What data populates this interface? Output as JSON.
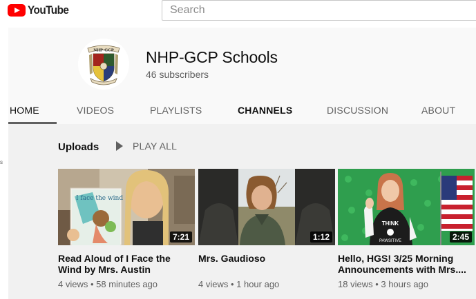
{
  "topbar": {
    "logo_text": "YouTube",
    "search_placeholder": "Search"
  },
  "channel": {
    "name": "NHP-GCP Schools",
    "subscribers": "46 subscribers",
    "crest_text": "NHP-GCP"
  },
  "tabs": [
    {
      "label": "HOME",
      "active": true
    },
    {
      "label": "VIDEOS"
    },
    {
      "label": "PLAYLISTS"
    },
    {
      "label": "CHANNELS"
    },
    {
      "label": "DISCUSSION"
    },
    {
      "label": "ABOUT"
    }
  ],
  "left_stub": "s",
  "uploads": {
    "title": "Uploads",
    "play_all": "PLAY ALL"
  },
  "videos": [
    {
      "title": "Read Aloud of I Face the Wind by Mrs. Austin",
      "meta": "4 views • 58 minutes ago",
      "duration": "7:21",
      "book_text": "I face the wind"
    },
    {
      "title": "Mrs. Gaudioso",
      "meta": "4 views • 1 hour ago",
      "duration": "1:12"
    },
    {
      "title": "Hello, HGS! 3/25 Morning Announcements with Mrs....",
      "meta": "18 views • 3 hours ago",
      "duration": "2:45",
      "shirt_text_1": "THINK",
      "shirt_text_2": "PAWSITIVE"
    }
  ],
  "colors": {
    "brand_red": "#ff0000",
    "header_bg": "#f9f9f9",
    "content_bg": "#f1f1f1",
    "text_secondary": "#606060"
  }
}
